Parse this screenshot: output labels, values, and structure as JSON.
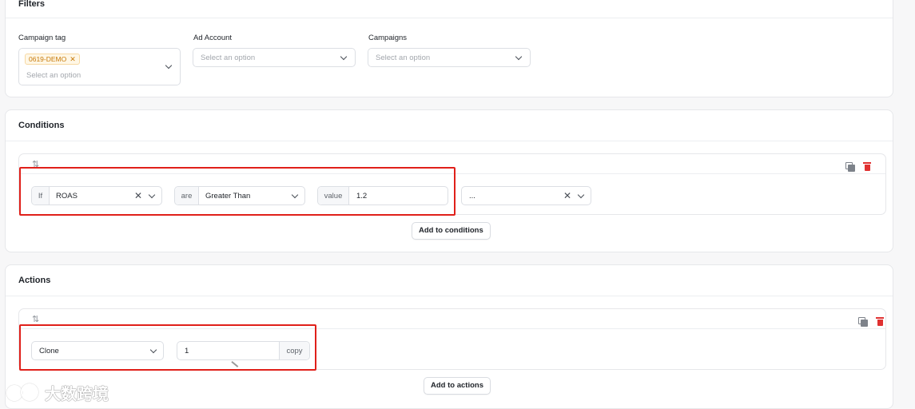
{
  "filters": {
    "title": "Filters",
    "campaign_tag": {
      "label": "Campaign tag",
      "tag": "0619-DEMO",
      "placeholder": "Select an option"
    },
    "ad_account": {
      "label": "Ad Account",
      "placeholder": "Select an option"
    },
    "campaigns": {
      "label": "Campaigns",
      "placeholder": "Select an option"
    }
  },
  "conditions": {
    "title": "Conditions",
    "if_label": "If",
    "metric": "ROAS",
    "are_label": "are",
    "operator": "Greater Than",
    "value_label": "value",
    "value": "1.2",
    "extra": "...",
    "add_button": "Add to conditions"
  },
  "actions": {
    "title": "Actions",
    "action": "Clone",
    "count": "1",
    "count_suffix": "copy",
    "add_button": "Add to actions"
  },
  "watermark": {
    "text": "大数跨境"
  },
  "colors": {
    "highlight": "#e0201a",
    "tag_bg": "#fff7e6",
    "tag_text": "#c77a0a",
    "delete": "#e03131"
  }
}
